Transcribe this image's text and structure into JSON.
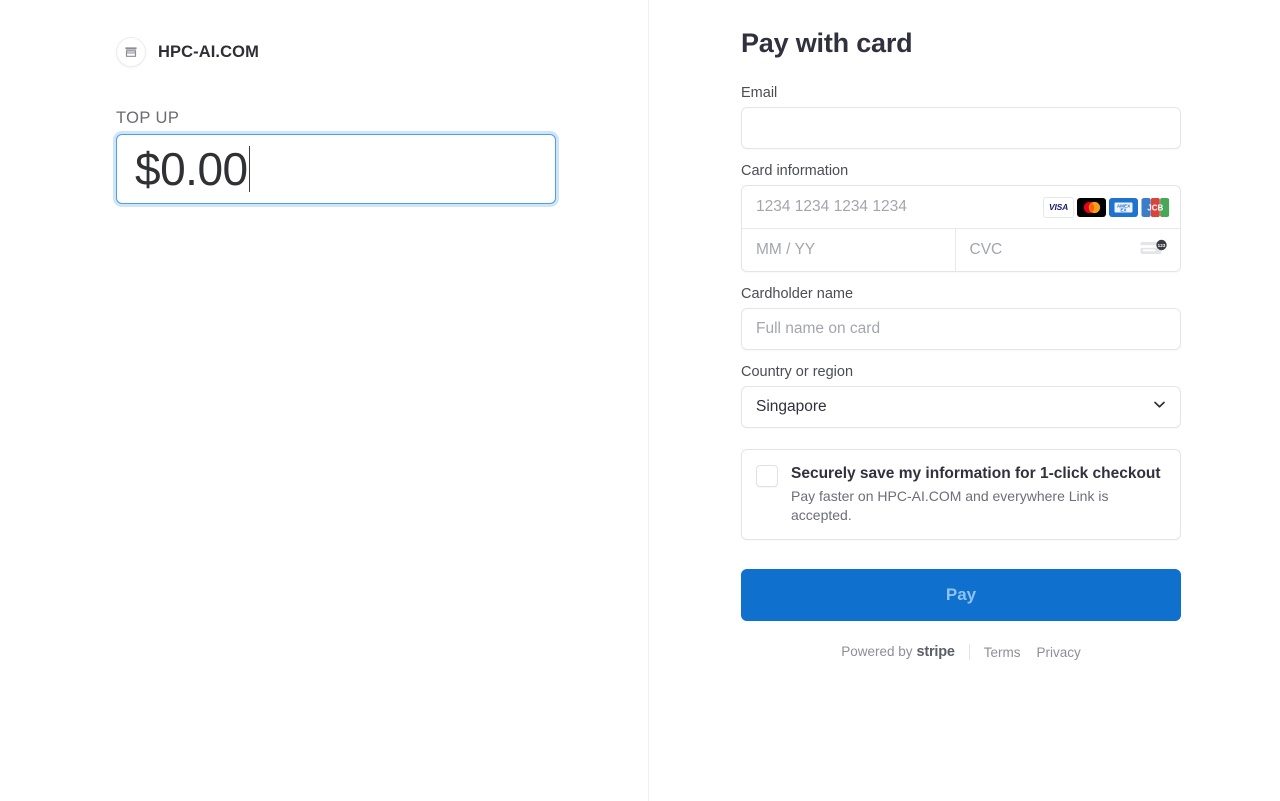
{
  "merchant": {
    "name": "HPC-AI.COM",
    "logo_icon": "storefront-icon"
  },
  "order": {
    "label": "TOP UP",
    "amount_value": "$0.00"
  },
  "payment": {
    "title": "Pay with card",
    "email": {
      "label": "Email",
      "value": "",
      "placeholder": ""
    },
    "card": {
      "label": "Card information",
      "number_placeholder": "1234 1234 1234 1234",
      "number_value": "",
      "expiry_placeholder": "MM / YY",
      "expiry_value": "",
      "cvc_placeholder": "CVC",
      "cvc_value": "",
      "brands": [
        {
          "name": "visa-icon",
          "label": "VISA"
        },
        {
          "name": "mastercard-icon",
          "label": "Mastercard"
        },
        {
          "name": "amex-icon",
          "label": "AMEX"
        },
        {
          "name": "jcb-icon",
          "label": "JCB"
        }
      ],
      "cvc_hint_icon": "cvc-card-icon",
      "cvc_hint_digits": "123"
    },
    "cardholder": {
      "label": "Cardholder name",
      "value": "",
      "placeholder": "Full name on card"
    },
    "country": {
      "label": "Country or region",
      "selected": "Singapore",
      "chevron_icon": "chevron-down-icon"
    },
    "save_info": {
      "checked": false,
      "title": "Securely save my information for 1-click checkout",
      "subtitle": "Pay faster on HPC-AI.COM and everywhere Link is accepted."
    },
    "submit_label": "Pay"
  },
  "footer": {
    "powered_by": "Powered by",
    "brand": "stripe",
    "terms": "Terms",
    "privacy": "Privacy"
  },
  "colors": {
    "accent": "#1070ce",
    "accent_text": "#8fc3ee",
    "focus_border": "#4d9fe8",
    "label": "#4b4d55",
    "placeholder": "#a3a6af"
  }
}
